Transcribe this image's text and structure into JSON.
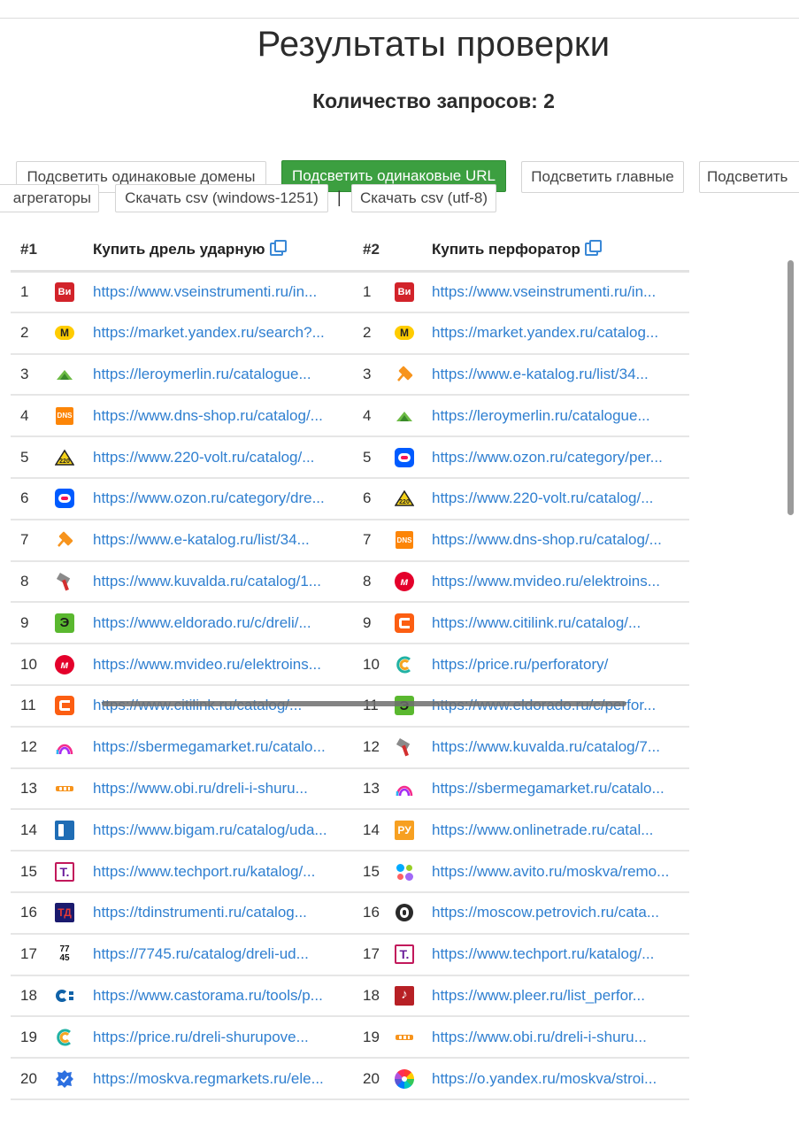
{
  "title": "Результаты проверки",
  "subtitle": "Количество запросов: 2",
  "buttons": {
    "highlight_domains": "Подсветить одинаковые домены",
    "highlight_urls": "Подсветить одинаковые URL",
    "highlight_main": "Подсветить главные",
    "highlight_cut": "Подсветить",
    "aggregators": "агрегаторы",
    "csv_win": "Скачать csv (windows-1251)",
    "separator": "|",
    "csv_utf": "Скачать csv (utf-8)"
  },
  "table": {
    "col1_num": "#1",
    "col1_query": "Купить дрель ударную",
    "col2_num": "#2",
    "col2_query": "Купить перфоратор",
    "rows": [
      {
        "n1": "1",
        "i1": "vseinstrumenti",
        "u1": "https://www.vseinstrumenti.ru/in...",
        "n2": "1",
        "i2": "vseinstrumenti",
        "u2": "https://www.vseinstrumenti.ru/in..."
      },
      {
        "n1": "2",
        "i1": "yandex-market",
        "u1": "https://market.yandex.ru/search?...",
        "n2": "2",
        "i2": "yandex-market",
        "u2": "https://market.yandex.ru/catalog..."
      },
      {
        "n1": "3",
        "i1": "leroymerlin",
        "u1": "https://leroymerlin.ru/catalogue...",
        "n2": "3",
        "i2": "e-katalog",
        "u2": "https://www.e-katalog.ru/list/34..."
      },
      {
        "n1": "4",
        "i1": "dns",
        "u1": "https://www.dns-shop.ru/catalog/...",
        "n2": "4",
        "i2": "leroymerlin",
        "u2": "https://leroymerlin.ru/catalogue..."
      },
      {
        "n1": "5",
        "i1": "220volt",
        "u1": "https://www.220-volt.ru/catalog/...",
        "n2": "5",
        "i2": "ozon",
        "u2": "https://www.ozon.ru/category/per..."
      },
      {
        "n1": "6",
        "i1": "ozon",
        "u1": "https://www.ozon.ru/category/dre...",
        "n2": "6",
        "i2": "220volt",
        "u2": "https://www.220-volt.ru/catalog/..."
      },
      {
        "n1": "7",
        "i1": "e-katalog",
        "u1": "https://www.e-katalog.ru/list/34...",
        "n2": "7",
        "i2": "dns",
        "u2": "https://www.dns-shop.ru/catalog/..."
      },
      {
        "n1": "8",
        "i1": "kuvalda",
        "u1": "https://www.kuvalda.ru/catalog/1...",
        "n2": "8",
        "i2": "mvideo",
        "u2": "https://www.mvideo.ru/elektroins..."
      },
      {
        "n1": "9",
        "i1": "eldorado",
        "u1": "https://www.eldorado.ru/c/dreli/...",
        "n2": "9",
        "i2": "citilink",
        "u2": "https://www.citilink.ru/catalog/..."
      },
      {
        "n1": "10",
        "i1": "mvideo",
        "u1": "https://www.mvideo.ru/elektroins...",
        "n2": "10",
        "i2": "price",
        "u2": "https://price.ru/perforatory/"
      },
      {
        "n1": "11",
        "i1": "citilink",
        "u1": "https://www.citilink.ru/catalog/...",
        "n2": "11",
        "i2": "eldorado",
        "u2": "https://www.eldorado.ru/c/perfor..."
      },
      {
        "n1": "12",
        "i1": "sbermegamarket",
        "u1": "https://sbermegamarket.ru/catalo...",
        "n2": "12",
        "i2": "kuvalda",
        "u2": "https://www.kuvalda.ru/catalog/7..."
      },
      {
        "n1": "13",
        "i1": "obi",
        "u1": "https://www.obi.ru/dreli-i-shuru...",
        "n2": "13",
        "i2": "sbermegamarket",
        "u2": "https://sbermegamarket.ru/catalo..."
      },
      {
        "n1": "14",
        "i1": "bigam",
        "u1": "https://www.bigam.ru/catalog/uda...",
        "n2": "14",
        "i2": "onlinetrade",
        "u2": "https://www.onlinetrade.ru/catal..."
      },
      {
        "n1": "15",
        "i1": "techport",
        "u1": "https://www.techport.ru/katalog/...",
        "n2": "15",
        "i2": "avito",
        "u2": "https://www.avito.ru/moskva/remo..."
      },
      {
        "n1": "16",
        "i1": "tdinstrumenti",
        "u1": "https://tdinstrumenti.ru/catalog...",
        "n2": "16",
        "i2": "petrovich",
        "u2": "https://moscow.petrovich.ru/cata..."
      },
      {
        "n1": "17",
        "i1": "7745",
        "u1": "https://7745.ru/catalog/dreli-ud...",
        "n2": "17",
        "i2": "techport",
        "u2": "https://www.techport.ru/katalog/..."
      },
      {
        "n1": "18",
        "i1": "castorama",
        "u1": "https://www.castorama.ru/tools/p...",
        "n2": "18",
        "i2": "pleer",
        "u2": "https://www.pleer.ru/list_perfor..."
      },
      {
        "n1": "19",
        "i1": "price",
        "u1": "https://price.ru/dreli-shurupove...",
        "n2": "19",
        "i2": "obi",
        "u2": "https://www.obi.ru/dreli-i-shuru..."
      },
      {
        "n1": "20",
        "i1": "regmarkets",
        "u1": "https://moskva.regmarkets.ru/ele...",
        "n2": "20",
        "i2": "o-yandex",
        "u2": "https://o.yandex.ru/moskva/stroi..."
      }
    ]
  }
}
